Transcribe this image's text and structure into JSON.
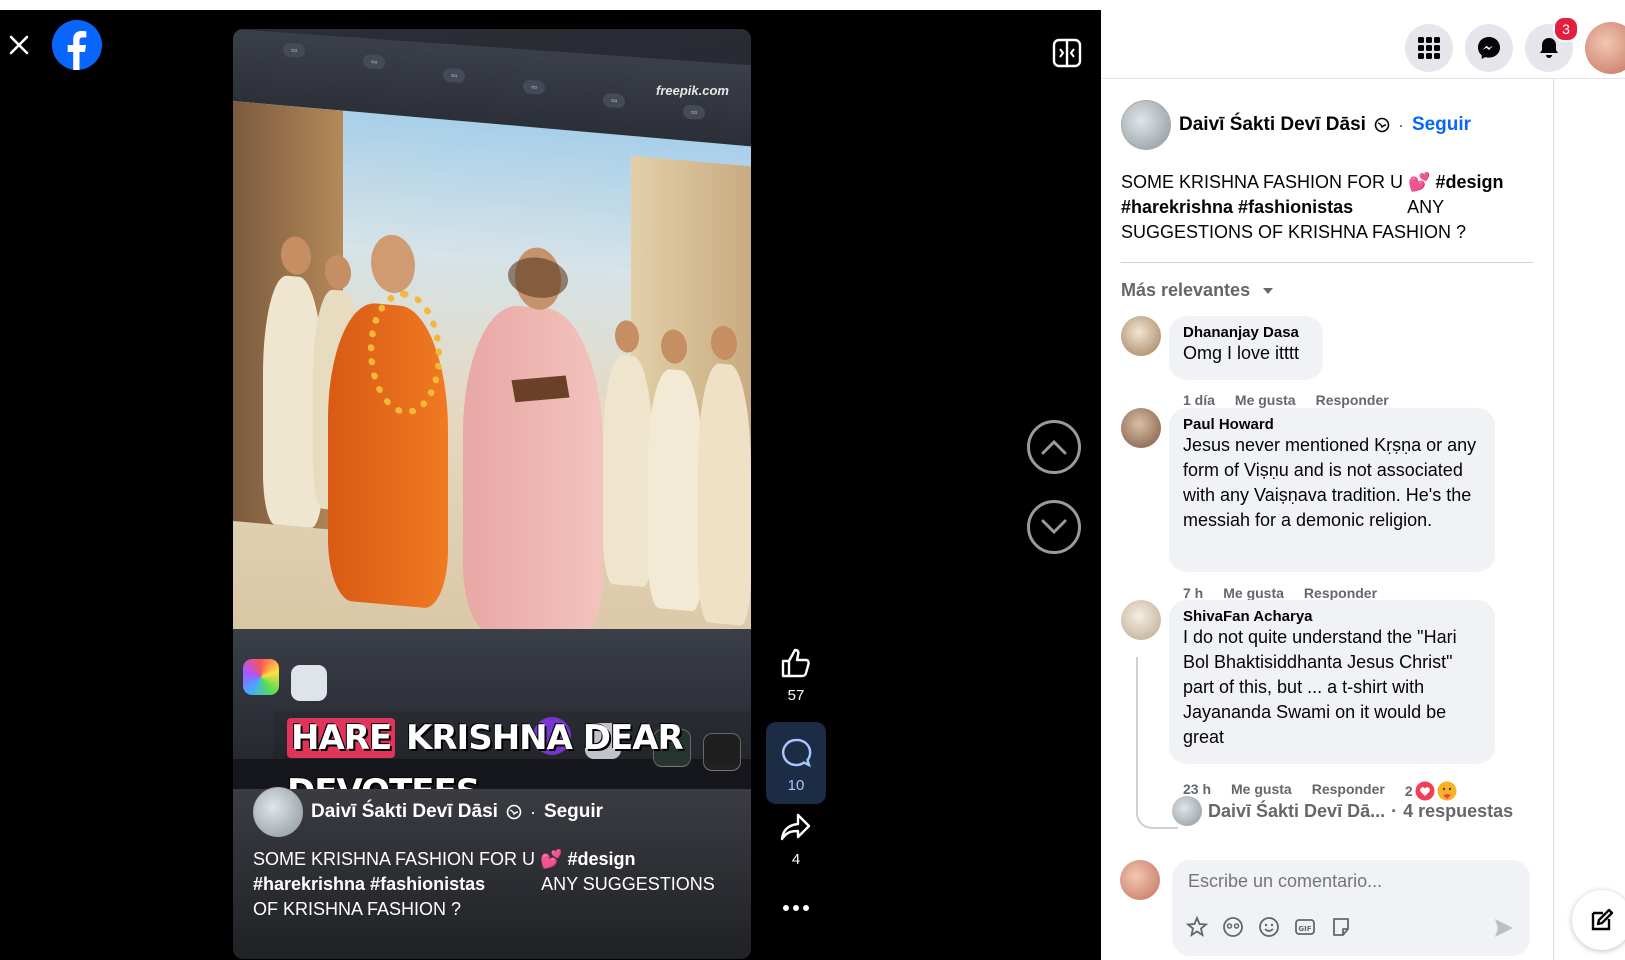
{
  "video": {
    "banner": {
      "word1": "HARE",
      "rest": "KRISHNA DEAR DEVOTEES"
    },
    "site_watermark": "freepik.com",
    "author": "Daivī Śakti Devī Dāsi",
    "follow_sep": "·",
    "follow": "Seguir",
    "description": {
      "line1_a": "SOME KRISHNA FASHION FOR U 💕 ",
      "line1_tag": "#design",
      "line2_tags": "#harekrishna #fashionistas",
      "line2_b": "ANY SUGGESTIONS",
      "line3": "OF KRISHNA FASHION ?"
    },
    "likes": "57",
    "comments": "10",
    "shares": "4"
  },
  "topbar": {
    "notifications_badge": "3"
  },
  "post": {
    "author": "Daivī Śakti Devī Dāsi",
    "dot": "·",
    "follow": "Seguir",
    "text_a": "SOME KRISHNA FASHION FOR U 💕 ",
    "tag1": "#design",
    "tags2": "#harekrishna #fashionistas",
    "text_b": "ANY",
    "text_c": "SUGGESTIONS OF KRISHNA FASHION ?"
  },
  "sort_label": "Más relevantes",
  "comments": [
    {
      "name": "Dhananjay Dasa",
      "text": "Omg I love itttt",
      "time": "1 día",
      "like": "Me gusta",
      "reply": "Responder"
    },
    {
      "name": "Paul Howard",
      "text": "Jesus never mentioned Kṛṣṇa or any form of Viṣṇu and is not associated with any Vaiṣṇava tradition. He's the messiah for a demonic religion.",
      "time": "7 h",
      "like": "Me gusta",
      "reply": "Responder"
    },
    {
      "name": "ShivaFan Acharya",
      "text": "I do not quite understand the \"Hari Bol Bhaktisiddhanta Jesus Christ\" part of this, but ... a t-shirt with Jayananda Swami on it would be great",
      "time": "23 h",
      "like": "Me gusta",
      "reply": "Responder",
      "reactions": "2"
    }
  ],
  "replies_summary": {
    "author": "Daivī Śakti Devī Dā...",
    "sep": "·",
    "count": "4 respuestas"
  },
  "composer": {
    "placeholder": "Escribe un comentario..."
  }
}
